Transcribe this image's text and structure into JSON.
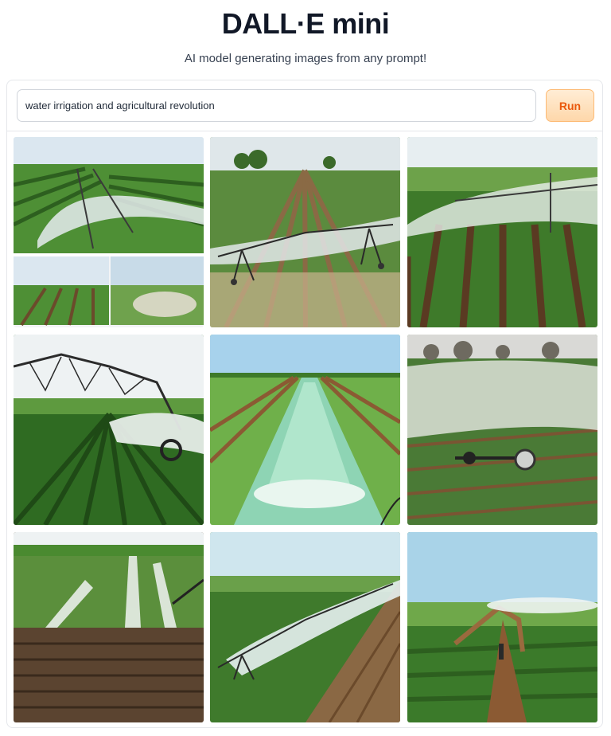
{
  "header": {
    "title": "DALL·E mini",
    "subtitle": "AI model generating images from any prompt!"
  },
  "prompt": {
    "value": "water irrigation and agricultural revolution",
    "placeholder": ""
  },
  "run_button": {
    "label": "Run"
  },
  "gallery": {
    "images": [
      {
        "scene": "pivot-sprinkler-field-collage"
      },
      {
        "scene": "pivot-sprinkler-muddy-furrows"
      },
      {
        "scene": "pivot-sprinkler-spray-rows"
      },
      {
        "scene": "center-pivot-truss-field"
      },
      {
        "scene": "irrigation-canal"
      },
      {
        "scene": "wheel-sprinkler-mist"
      },
      {
        "scene": "multiple-sprinklers-soil"
      },
      {
        "scene": "sprinkler-spray-crop"
      },
      {
        "scene": "arch-sprinkler-crop"
      }
    ]
  },
  "colors": {
    "run_text": "#ea580c",
    "run_bg": "#fed7aa",
    "crop_green": "#3f8f2b",
    "soil_brown": "#6b4a2b",
    "sky": "#cfe3ee"
  }
}
